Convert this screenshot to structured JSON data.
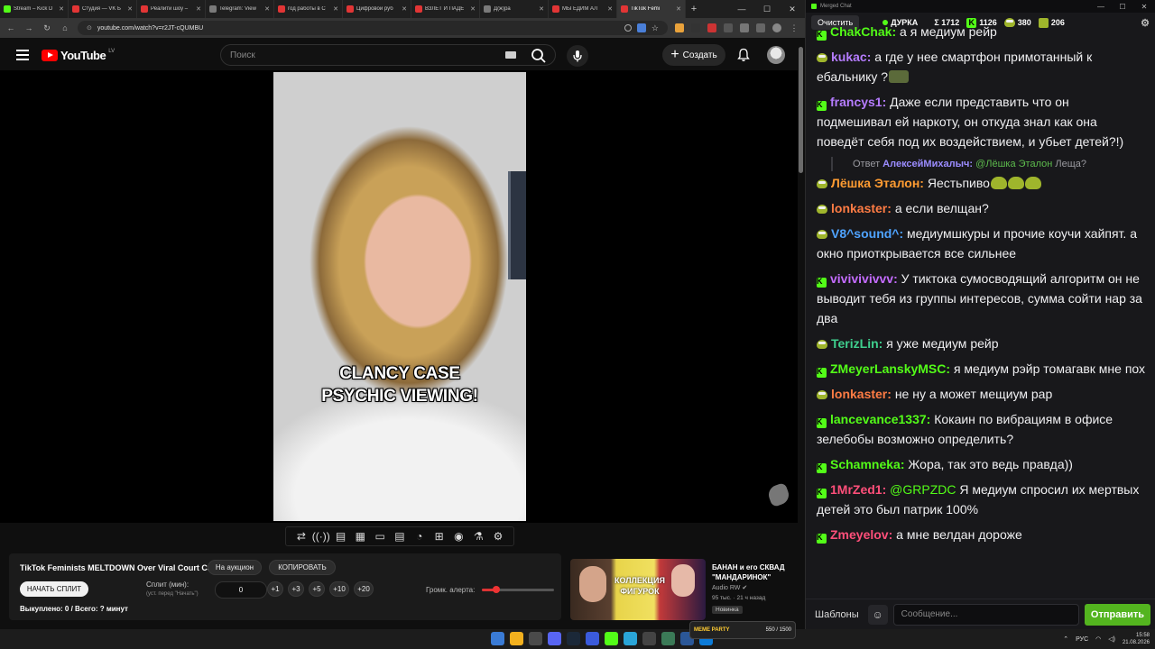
{
  "browser": {
    "tabs": [
      {
        "title": "Stream – Kick D",
        "color": "#53fc18",
        "active": false
      },
      {
        "title": "Студия — VK Б",
        "color": "#e23535",
        "active": false
      },
      {
        "title": "Реалити шоу –",
        "color": "#e23535",
        "active": false
      },
      {
        "title": "Telegram: View",
        "color": "#7a7a7a",
        "active": false
      },
      {
        "title": "год работы в С",
        "color": "#e23535",
        "active": false
      },
      {
        "title": "Цифровой руб",
        "color": "#e23535",
        "active": false
      },
      {
        "title": "ВЗЛЕТ И ПАДЕ",
        "color": "#e23535",
        "active": false
      },
      {
        "title": "Д(ж)ра",
        "color": "#7a7a7a",
        "active": false
      },
      {
        "title": "МЫ ЕДИМ АЛ",
        "color": "#e23535",
        "active": false
      },
      {
        "title": "TikTok Femi",
        "color": "#e23535",
        "active": true
      }
    ],
    "url": "youtube.com/watch?v=r2JT-cQUMBU"
  },
  "youtube": {
    "logo_text": "YouTube",
    "region": "LV",
    "search_placeholder": "Поиск",
    "create_label": "Создать"
  },
  "video": {
    "caption_line1": "CLANCY CASE",
    "caption_line2": "PSYCHIC VIEWING!"
  },
  "extension_toolbar": [
    "⇄",
    "((·))",
    "▤",
    "▦",
    "▭",
    "▤",
    "◔",
    "⊞",
    "◉",
    "⚗",
    "⚙"
  ],
  "split": {
    "title": "TikTok Feminists MELTDOWN Over Viral Court Case",
    "auction_label": "На аукцион",
    "copy_label": "КОПИРОВАТЬ",
    "start_label": "НАЧАТЬ СПЛИТ",
    "split_label": "Сплит (мин):",
    "split_hint": "(уст. перед \"Начать\")",
    "split_value": "0",
    "increments": [
      "+1",
      "+3",
      "+5",
      "+10",
      "+20"
    ],
    "status": "Выкуплено: 0 / Всего: ? минут",
    "volume_label": "Громк. алерта:",
    "volume_level": 0.2
  },
  "recommendation": {
    "thumb_text": "КОЛЛЕКЦИЯ ФИГУРОК",
    "title": "БАНАН и его СКВАД \"МАНДАРИНОК\"",
    "channel": "Audio RW",
    "meta": "95 тыс. · 21 ч назад",
    "badge": "Новинка"
  },
  "chat": {
    "window_title": "Merged Chat",
    "clear_label": "Очистить",
    "channel_name": "ДУРКА",
    "total_viewers": "Σ 1712",
    "kick_viewers": "1126",
    "pepe_viewers": "380",
    "other_viewers": "206",
    "messages": [
      {
        "platform": "kick",
        "user": "ChakChak",
        "color": "#53fc18",
        "text": "а я медиум рейр"
      },
      {
        "platform": "pepe",
        "user": "kukac",
        "color": "#b57cff",
        "text": "а где у нее смартфон примотанный  к ебальнику ?",
        "emote": "tank"
      },
      {
        "platform": "kick",
        "user": "francys1",
        "color": "#b57cff",
        "text": "Даже если представить что он подмешивал ей наркоту, он откуда знал как она поведёт себя под их воздействием, и убьет детей?!)"
      },
      {
        "reply": true,
        "reply_prefix": "Ответ",
        "reply_user": "АлексейМихалыч:",
        "reply_mention": "@Лёшка Эталон",
        "reply_text": "Леща?"
      },
      {
        "platform": "pepe",
        "user": "Лёшка Эталон",
        "color": "#ff9c32",
        "text": "Яестьпиво",
        "emote": "pepe3"
      },
      {
        "platform": "pepe",
        "user": "lonkaster",
        "color": "#ff7c44",
        "text": "а если велщан?"
      },
      {
        "platform": "pepe",
        "user": "V8^sound^",
        "color": "#4fa3ff",
        "text": "медиумшкуры и прочие коучи хайпят. а окно приоткрывается все сильнее"
      },
      {
        "platform": "kick",
        "user": "vivivivivvv",
        "color": "#c46cff",
        "text": "У тиктока сумосводящий алгоритм он не выводит тебя из группы интересов, сумма сойти нар за два"
      },
      {
        "platform": "pepe",
        "user": "TerizLin",
        "color": "#3fcf8e",
        "text": "я уже медиум рейр"
      },
      {
        "platform": "kick",
        "user": "ZMeyerLanskyMSC",
        "color": "#53fc18",
        "text": "я медиум рэйр томагавк мне пох"
      },
      {
        "platform": "pepe",
        "user": "lonkaster",
        "color": "#ff7c44",
        "text": "не ну а может мещиум рар"
      },
      {
        "platform": "kick",
        "user": "lancevance1337",
        "color": "#53fc18",
        "text": "Кокаин по вибрациям в офисе зелебобы возможно определить?"
      },
      {
        "platform": "kick",
        "user": "Schamneka",
        "color": "#53fc18",
        "text": "Жора, так это ведь правда))"
      },
      {
        "platform": "kick",
        "user": "1MrZed1",
        "color": "#ff4f7a",
        "mention": "@GRPZDC",
        "text": "Я медиум спросил их мертвых детей это был патрик 100%"
      },
      {
        "platform": "kick",
        "user": "Zmeyelov",
        "color": "#ff4f7a",
        "text": "а мне велдан дороже"
      }
    ],
    "templates_label": "Шаблоны",
    "input_placeholder": "Сообщение...",
    "send_label": "Отправить"
  },
  "taskbar": {
    "meme_party_title": "MEME PARTY",
    "meme_party_progress": "550 / 1500",
    "lang": "РУС",
    "time": "15:58",
    "date": "21.08.2026",
    "icon_colors": [
      "#3a7bd5",
      "#f2b01e",
      "#4a4a4a",
      "#5865f2",
      "#1b2838",
      "#3b5bdb",
      "#53fc18",
      "#2aa5d8",
      "#444",
      "#3b7a57",
      "#2b5797",
      "#0c7bd8"
    ]
  }
}
